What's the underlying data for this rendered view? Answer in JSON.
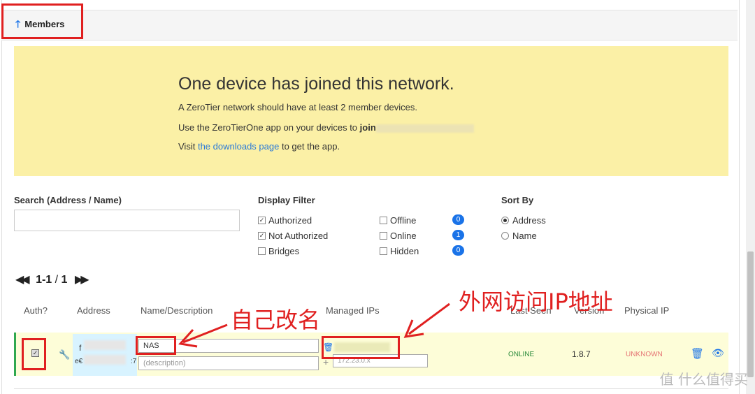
{
  "members": {
    "title": "Members"
  },
  "notice": {
    "heading": "One device has joined this network.",
    "line1": "A ZeroTier network should have at least 2 member devices.",
    "line2_prefix": "Use the ZeroTierOne app on your devices to",
    "line2_join": "join",
    "line3_prefix": "Visit",
    "line3_link": "the downloads page",
    "line3_suffix": "to get the app."
  },
  "search": {
    "label": "Search (Address / Name)",
    "value": ""
  },
  "filter": {
    "label": "Display Filter",
    "authorized": {
      "label": "Authorized",
      "checked": true
    },
    "not_authorized": {
      "label": "Not Authorized",
      "checked": true
    },
    "bridges": {
      "label": "Bridges",
      "checked": false
    },
    "offline": {
      "label": "Offline",
      "checked": false,
      "count": "0"
    },
    "online": {
      "label": "Online",
      "checked": false,
      "count": "1"
    },
    "hidden": {
      "label": "Hidden",
      "checked": false,
      "count": "0"
    }
  },
  "sort": {
    "label": "Sort By",
    "address": {
      "label": "Address",
      "selected": true
    },
    "name": {
      "label": "Name",
      "selected": false
    }
  },
  "pager": {
    "range": "1-1",
    "sep": "/",
    "total": "1"
  },
  "table": {
    "headers": {
      "auth": "Auth?",
      "address": "Address",
      "name": "Name/Description",
      "ips": "Managed IPs",
      "last_seen": "Last Seen",
      "version": "Version",
      "physical_ip": "Physical IP"
    },
    "row": {
      "authorized": true,
      "address_line1": "f",
      "address_line2": "e€",
      "address_suffix": ":7",
      "name": "NAS",
      "description_placeholder": "(description)",
      "ip_placeholder": "172.23.0.x",
      "status": "ONLINE",
      "version": "1.8.7",
      "physical_ip": "UNKNOWN"
    }
  },
  "annotations": {
    "rename": "自己改名",
    "managed_ip": "外网访问IP地址"
  },
  "watermark": "值 什么值得买",
  "colors": {
    "accent": "#1a73e8",
    "annotation": "#e02020",
    "notice_bg": "#fbf0a6",
    "row_bg": "#fdfdd8"
  }
}
